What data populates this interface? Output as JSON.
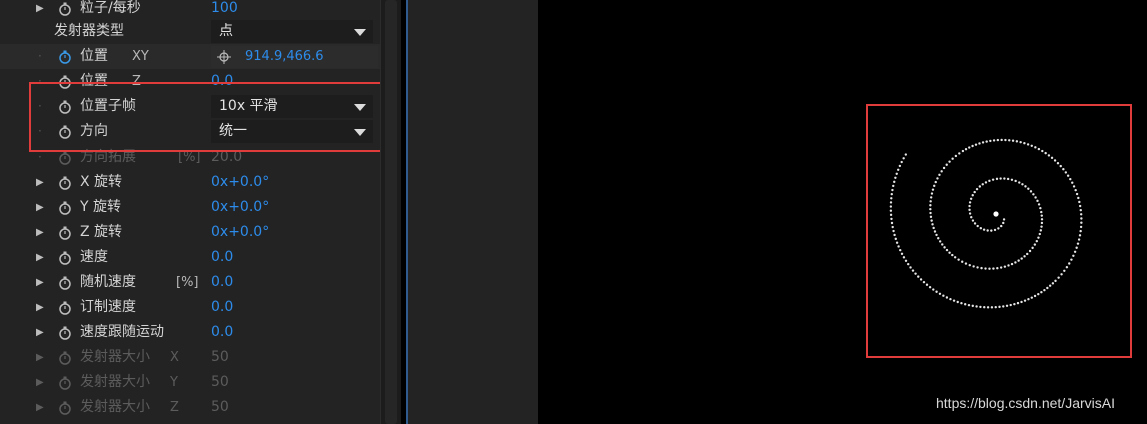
{
  "properties": {
    "particles_per_sec": {
      "label": "粒子/每秒",
      "value": "100"
    },
    "emitter_type": {
      "label": "发射器类型",
      "value": "点"
    },
    "position_xy": {
      "label": "位置",
      "suffix": "XY",
      "value": "914.9,466.6"
    },
    "position_z": {
      "label": "位置",
      "suffix": "Z",
      "value": "0.0"
    },
    "position_subframe": {
      "label": "位置子帧",
      "value": "10x 平滑"
    },
    "direction": {
      "label": "方向",
      "value": "统一"
    },
    "direction_spread": {
      "label": "方向拓展",
      "suffix": "[%]",
      "value": "20.0"
    },
    "x_rotation": {
      "label": "X 旋转",
      "value": "0x+0.0°"
    },
    "y_rotation": {
      "label": "Y 旋转",
      "value": "0x+0.0°"
    },
    "z_rotation": {
      "label": "Z 旋转",
      "value": "0x+0.0°"
    },
    "velocity": {
      "label": "速度",
      "value": "0.0"
    },
    "velocity_random": {
      "label": "随机速度",
      "suffix": "[%]",
      "value": "0.0"
    },
    "velocity_custom": {
      "label": "订制速度",
      "value": "0.0"
    },
    "velocity_follow": {
      "label": "速度跟随运动",
      "value": "0.0"
    },
    "emitter_size_x": {
      "label": "发射器大小",
      "suffix": "X",
      "value": "50"
    },
    "emitter_size_y": {
      "label": "发射器大小",
      "suffix": "Y",
      "value": "50"
    },
    "emitter_size_z": {
      "label": "发射器大小",
      "suffix": "Z",
      "value": "50"
    }
  },
  "watermark": "https://blog.csdn.net/JarvisAI",
  "colors": {
    "value_blue": "#2d8ceb",
    "highlight_red": "#e03c3c",
    "panel_bg": "#232323"
  },
  "icons": [
    "stopwatch-icon",
    "expand-triangle-icon",
    "crosshair-icon",
    "dropdown-arrow-icon"
  ]
}
